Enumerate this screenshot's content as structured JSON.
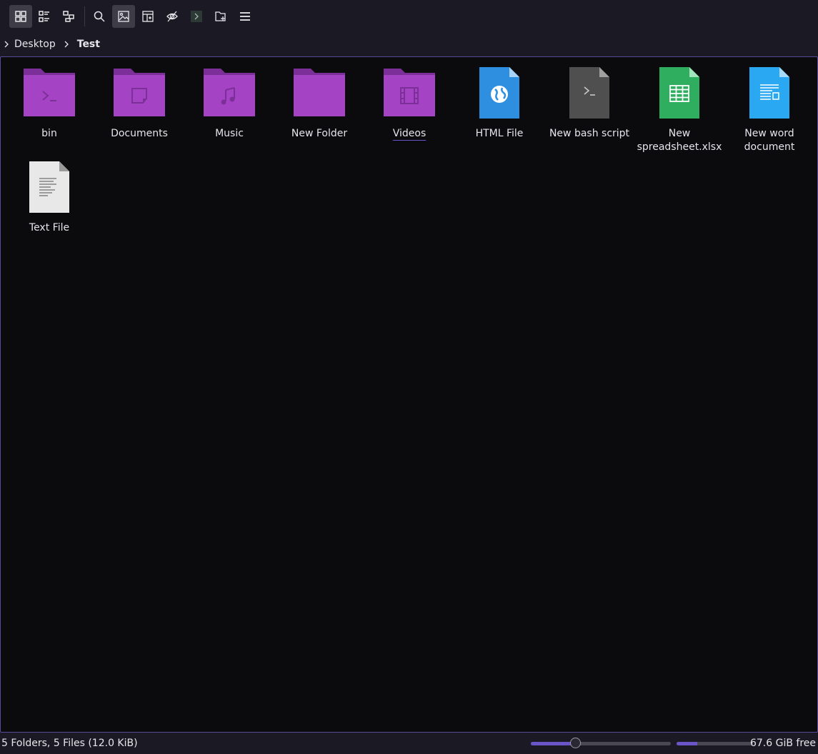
{
  "toolbar": {
    "buttons": [
      {
        "name": "icons-view-button",
        "icon": "icons-view-icon",
        "active": true
      },
      {
        "name": "compact-view-button",
        "icon": "compact-view-icon"
      },
      {
        "name": "details-view-button",
        "icon": "details-view-icon"
      },
      {
        "name": "search-button",
        "icon": "search-icon"
      },
      {
        "name": "preview-button",
        "icon": "image-icon",
        "active": true
      },
      {
        "name": "split-button",
        "icon": "split-view-icon"
      },
      {
        "name": "show-hidden-button",
        "icon": "hidden-eye-icon"
      },
      {
        "name": "terminal-button",
        "icon": "terminal-icon"
      },
      {
        "name": "new-folder-button",
        "icon": "new-folder-icon"
      },
      {
        "name": "menu-button",
        "icon": "hamburger-icon"
      }
    ]
  },
  "breadcrumb": {
    "items": [
      "Desktop",
      "Test"
    ]
  },
  "files": {
    "items": [
      {
        "label": "bin",
        "type": "folder",
        "emblem": "terminal"
      },
      {
        "label": "Documents",
        "type": "folder",
        "emblem": "document"
      },
      {
        "label": "Music",
        "type": "folder",
        "emblem": "music"
      },
      {
        "label": "New Folder",
        "type": "folder",
        "emblem": "none"
      },
      {
        "label": "Videos",
        "type": "folder",
        "emblem": "film"
      },
      {
        "label": "HTML File",
        "type": "html"
      },
      {
        "label": "New bash script",
        "type": "script"
      },
      {
        "label": "New spreadsheet.xlsx",
        "type": "spreadsheet"
      },
      {
        "label": "New word document",
        "type": "word"
      },
      {
        "label": "Text File",
        "type": "text"
      }
    ]
  },
  "status": {
    "summary": "5 Folders, 5 Files (12.0 KiB)",
    "zoom_fraction": 0.32,
    "space_used_fraction": 0.27,
    "free_space": "67.6 GiB free"
  },
  "colors": {
    "accent": "#6a55c8",
    "folder": "#a443c4",
    "folder_tab": "#7d2f99",
    "html": "#2e8fe0",
    "script": "#4f4f4f",
    "spreadsheet": "#2fae60",
    "word": "#2aa8f2",
    "text": "#e8e8e8"
  }
}
